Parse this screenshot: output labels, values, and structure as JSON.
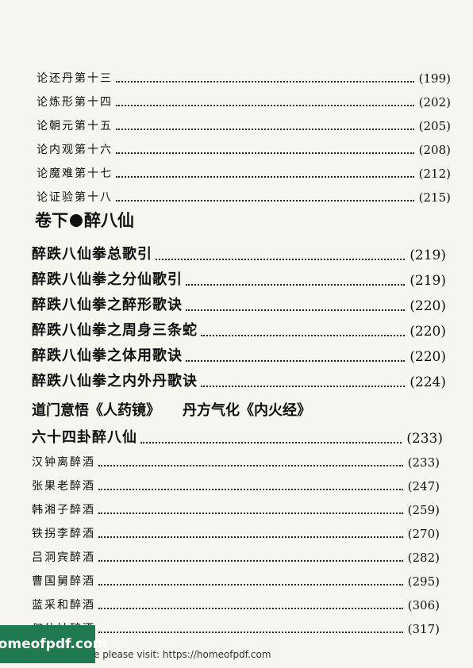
{
  "toc_small_1": [
    {
      "title": "论还丹第十三",
      "page": "(199)"
    },
    {
      "title": "论炼形第十四",
      "page": "(202)"
    },
    {
      "title": "论朝元第十五",
      "page": "(205)"
    },
    {
      "title": "论内观第十六",
      "page": "(208)"
    },
    {
      "title": "论魔难第十七",
      "page": "(212)"
    },
    {
      "title": "论证验第十八",
      "page": "(215)"
    }
  ],
  "section_heading": {
    "part1": "卷下",
    "part2": "醉八仙"
  },
  "toc_big": [
    {
      "title": "醉跌八仙拳总歌引",
      "page": "(219)"
    },
    {
      "title": "醉跌八仙拳之分仙歌引",
      "page": "(219)"
    },
    {
      "title": "醉跌八仙拳之醉形歌诀",
      "page": "(220)"
    },
    {
      "title": "醉跌八仙拳之周身三条蛇",
      "page": "(220)"
    },
    {
      "title": "醉跌八仙拳之体用歌诀",
      "page": "(220)"
    },
    {
      "title": "醉跌八仙拳之内外丹歌诀",
      "page": "(224)"
    }
  ],
  "subheading": {
    "left": "道门意悟《人药镜》",
    "right": "丹方气化《内火经》"
  },
  "toc_sixty_four": {
    "title": "六十四卦醉八仙",
    "page": "(233)"
  },
  "toc_small_2": [
    {
      "title": "汉钟离醉酒",
      "page": "(233)"
    },
    {
      "title": "张果老醉酒",
      "page": "(247)"
    },
    {
      "title": "韩湘子醉酒",
      "page": "(259)"
    },
    {
      "title": "铁拐李醉酒",
      "page": "(270)"
    },
    {
      "title": "吕洞宾醉酒",
      "page": "(282)"
    },
    {
      "title": "曹国舅醉酒",
      "page": "(295)"
    },
    {
      "title": "蓝采和醉酒",
      "page": "(306)"
    },
    {
      "title": "何仙姑醉酒",
      "page": "(317)"
    }
  ],
  "footer": {
    "banner": "homeofpdf.com",
    "visit": "e please visit: https://homeofpdf.com"
  }
}
